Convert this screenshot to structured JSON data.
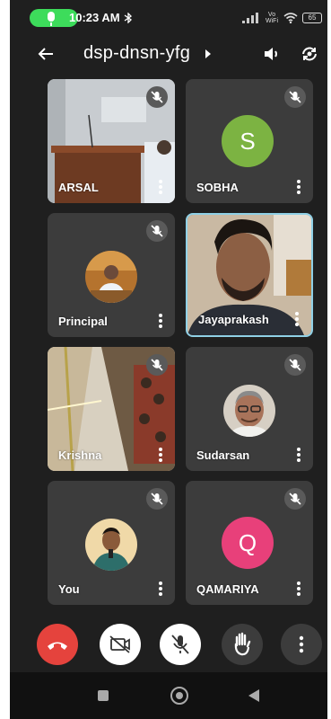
{
  "status_bar": {
    "time": "10:23 AM",
    "battery": "65",
    "network_label": "Vo WiFi"
  },
  "header": {
    "meeting_code": "dsp-dnsn-yfg"
  },
  "participants": [
    {
      "name": "ARSAL",
      "muted": true,
      "video": "camera"
    },
    {
      "name": "SOBHA",
      "muted": true,
      "avatar_letter": "S",
      "avatar_color": "#7cb342"
    },
    {
      "name": "Principal",
      "muted": true,
      "avatar": "photo"
    },
    {
      "name": "Jayaprakash",
      "muted": false,
      "video": "camera",
      "active_speaker": true
    },
    {
      "name": "Krishna",
      "muted": true,
      "video": "camera"
    },
    {
      "name": "Sudarsan",
      "muted": true,
      "avatar": "photo"
    },
    {
      "name": "You",
      "muted": true,
      "avatar": "photo"
    },
    {
      "name": "QAMARIYA",
      "muted": true,
      "avatar_letter": "Q",
      "avatar_color": "#e8407a"
    }
  ],
  "controls": [
    "end-call",
    "camera-off",
    "mic-off",
    "raise-hand",
    "more-options"
  ],
  "colors": {
    "background": "#1f1f1f",
    "tile": "#3c3c3c",
    "end_call": "#e5433d",
    "active_border": "#8fd0e6",
    "call_pill": "#3ddc5b"
  }
}
